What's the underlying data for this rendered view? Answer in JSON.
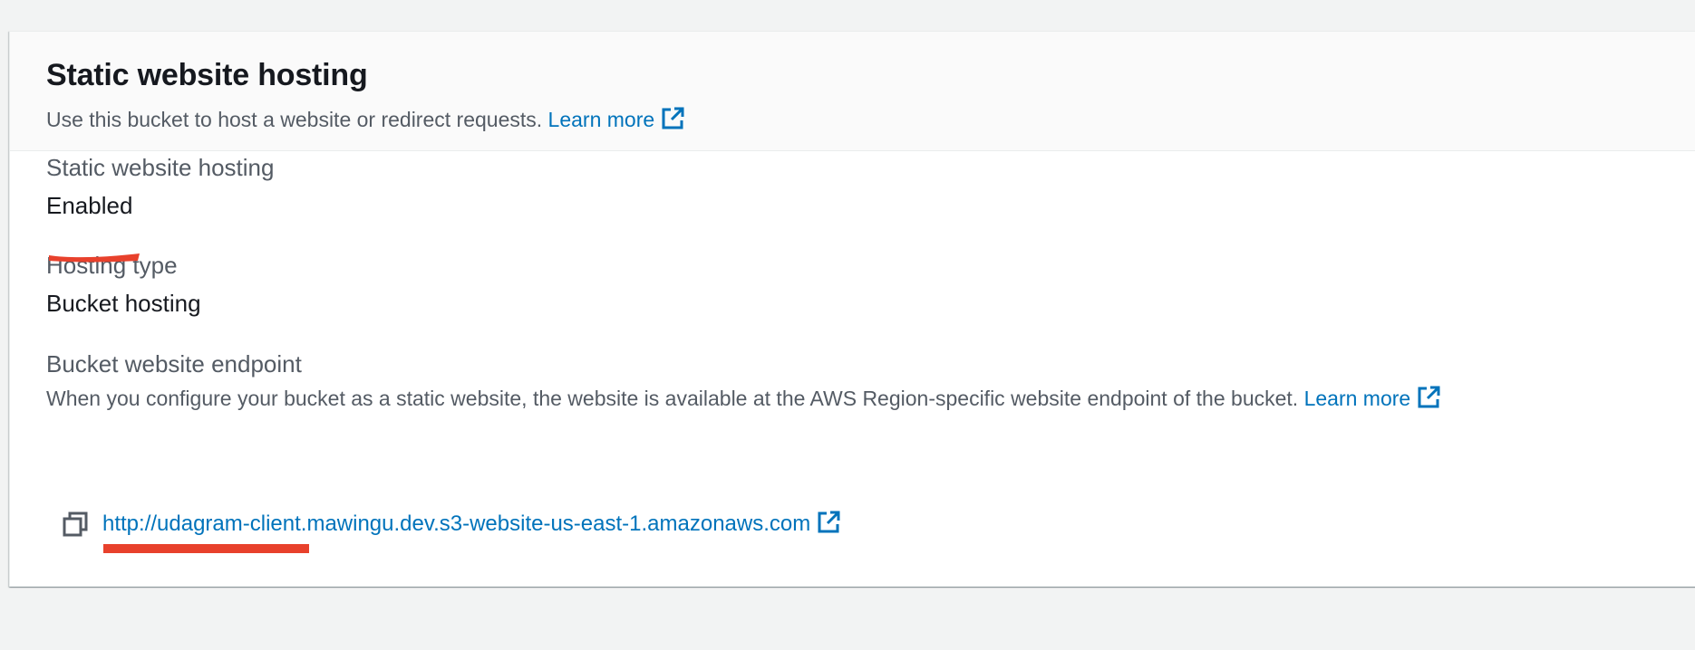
{
  "panel": {
    "title": "Static website hosting",
    "description": "Use this bucket to host a website or redirect requests.",
    "learn_more_label": "Learn more"
  },
  "fields": {
    "status": {
      "label": "Static website hosting",
      "value": "Enabled"
    },
    "hosting_type": {
      "label": "Hosting type",
      "value": "Bucket hosting"
    },
    "endpoint": {
      "label": "Bucket website endpoint",
      "description": "When you configure your bucket as a static website, the website is available at the AWS Region-specific website endpoint of the bucket.",
      "learn_more_label": "Learn more",
      "url": "http://udagram-client.mawingu.dev.s3-website-us-east-1.amazonaws.com"
    }
  },
  "icons": {
    "external_link": "external-link-icon",
    "copy": "copy-icon"
  },
  "colors": {
    "link": "#0073bb",
    "annotation": "#e8412c",
    "background": "#f2f3f3",
    "panel_header": "#fafafa"
  }
}
